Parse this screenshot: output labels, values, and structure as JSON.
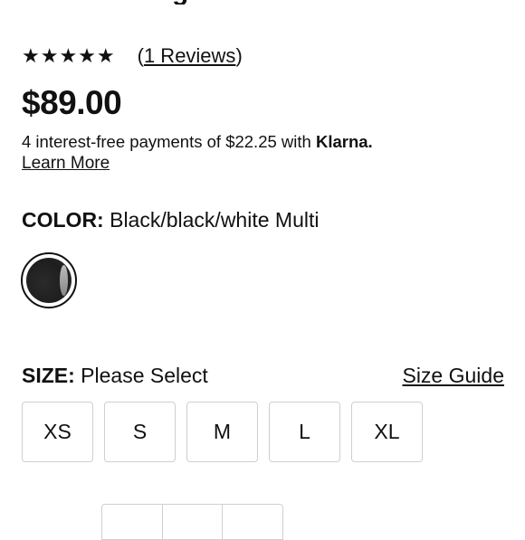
{
  "product": {
    "title_fragment": "g",
    "rating": {
      "stars": "★★★★★",
      "value": 5,
      "reviews_open": "(",
      "reviews_label": "1 Reviews",
      "reviews_close": ")"
    },
    "price": "$89.00",
    "financing": {
      "text": "4 interest-free payments of $22.25 with ",
      "provider": "Klarna.",
      "learn_more": "Learn More"
    },
    "color": {
      "label": "COLOR:",
      "value": " Black/black/white Multi",
      "swatches": [
        {
          "name": "Black/black/white Multi",
          "selected": true
        }
      ]
    },
    "size": {
      "label": "SIZE:",
      "value": " Please Select",
      "guide_link": "Size Guide",
      "options": [
        "XS",
        "S",
        "M",
        "L",
        "XL"
      ]
    }
  }
}
